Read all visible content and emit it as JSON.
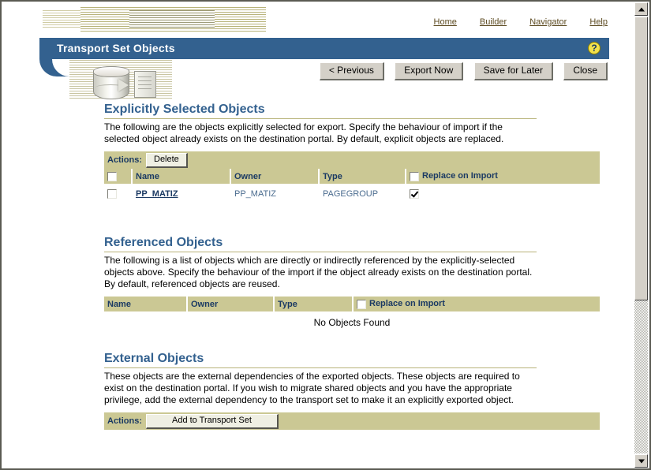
{
  "window": {
    "title": "Transport Set Objects"
  },
  "nav": {
    "links": [
      {
        "label": "Home",
        "name": "nav-link-home"
      },
      {
        "label": "Builder",
        "name": "nav-link-builder"
      },
      {
        "label": "Navigator",
        "name": "nav-link-navigator"
      },
      {
        "label": "Help",
        "name": "nav-link-help"
      }
    ]
  },
  "titlebar": {
    "title": "Transport Set Objects",
    "help_icon": "question-mark-icon",
    "help_glyph": "?",
    "background": "#33618f"
  },
  "toolbar": {
    "buttons": [
      {
        "label": "< Previous",
        "name": "previous-button"
      },
      {
        "label": "Export Now",
        "name": "export-now-button"
      },
      {
        "label": "Save for Later",
        "name": "save-for-later-button"
      },
      {
        "label": "Close",
        "name": "close-button"
      }
    ]
  },
  "sections": {
    "explicit": {
      "title": "Explicitly Selected Objects",
      "description": "The following are the objects explicitly selected for export. Specify the behaviour of import if the selected object already exists on the destination portal. By default, explicit objects are replaced.",
      "actions_label": "Actions:",
      "action_button": "Delete",
      "columns": [
        "",
        "Name",
        "Owner",
        "Type",
        "Replace on Import"
      ],
      "header_select_all_checked": false,
      "header_replace_checked": false,
      "rows": [
        {
          "selected": false,
          "name": "PP_MATIZ",
          "owner": "PP_MATIZ",
          "type": "PAGEGROUP",
          "replace_on_import": true
        }
      ]
    },
    "referenced": {
      "title": "Referenced Objects",
      "description": "The following is a list of objects which are directly or indirectly referenced by the explicitly-selected objects above. Specify the behaviour of the import if the object already exists on the destination portal. By default, referenced objects are reused.",
      "columns": [
        "Name",
        "Owner",
        "Type",
        "Replace on Import"
      ],
      "header_replace_checked": false,
      "rows": [],
      "empty_message": "No Objects Found"
    },
    "external": {
      "title": "External Objects",
      "description": "These objects are the external dependencies of the exported objects. These objects are required to exist on the destination portal. If you wish to migrate shared objects and you have the appropriate privilege, add the external dependency to the transport set to make it an explicitly exported object.",
      "actions_label": "Actions:",
      "action_button": "Add to Transport Set"
    }
  },
  "scrollbar": {
    "up_arrow": "scroll-up-icon",
    "down_arrow": "scroll-down-icon"
  },
  "colors": {
    "accent_blue": "#33618f",
    "bar_khaki": "#cbc894",
    "link_brown": "#5c4a20",
    "help_yellow": "#f2e14c"
  }
}
